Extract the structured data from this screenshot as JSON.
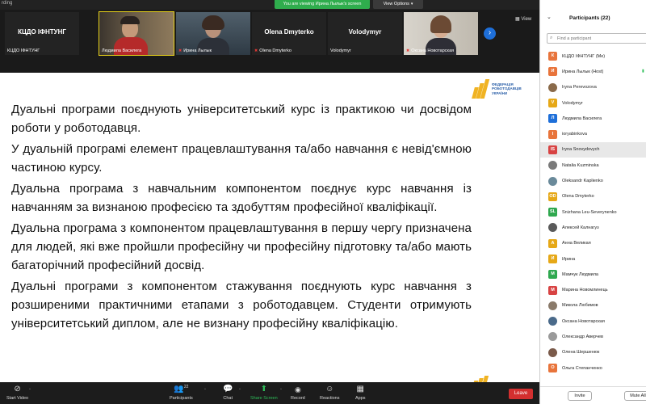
{
  "window": {
    "title": "rding"
  },
  "topbar": {
    "viewing_banner": "You are viewing Ирина Лылык's screen",
    "view_options": "View Options",
    "view_label": "View"
  },
  "gallery": {
    "recording_label": "rding",
    "tiles": [
      {
        "big_name": "КЦДО ІФНТУНГ",
        "label": "КЦДО ІФНТУНГ",
        "muted": false
      },
      {
        "big_name": "",
        "label": "Людмила Василега",
        "muted": false
      },
      {
        "big_name": "",
        "label": "Ирина Лылык",
        "muted": true
      },
      {
        "big_name": "Olena Dmyterko",
        "label": "Olena Dmyterko",
        "muted": true
      },
      {
        "big_name": "Volodymyr",
        "label": "Volodymyr",
        "muted": false
      },
      {
        "big_name": "",
        "label": "Оксана Новотарская",
        "muted": true
      }
    ]
  },
  "slide": {
    "logo_text": "ФЕДЕРАЦІЯ РОБОТОДАВЦІВ УКРАЇНИ",
    "paragraphs": [
      "Дуальні програми поєднують університетський курс із практикою чи досвідом роботи у роботодавця.",
      "У дуальній програмі елемент працевлаштування та/або навчання є невід'ємною частиною курсу.",
      "Дуальна програма з навчальним компонентом поєднує курс навчання із навчанням за визнаною професією та здобуттям професійної кваліфікації.",
      "Дуальна програма з компонентом працевлаштування в першу чергу призначена для людей, які вже пройшли професійну чи професійну підготовку та/або мають багаторічний професійний досвід.",
      "Дуальні програми з компонентом стажування поєднують курс навчання з розширеними практичними етапами з роботодавцем. Студенти отримують університетський диплом, але не визнану професійну кваліфікацію."
    ]
  },
  "toolbar": {
    "start_video": "Start Video",
    "participants": "Participants",
    "participants_count": "22",
    "chat": "Chat",
    "share_screen": "Share Screen",
    "record": "Record",
    "reactions": "Reactions",
    "apps": "Apps",
    "leave": "Leave"
  },
  "panel": {
    "title": "Participants (22)",
    "search_placeholder": "Find a participant",
    "invite": "Invite",
    "mute_all": "Mute All",
    "participants": [
      {
        "initial": "К",
        "color": "#e8743b",
        "name": "КЦДО ІФНТУНГ (Me)",
        "photo": false
      },
      {
        "initial": "И",
        "color": "#e8743b",
        "name": "Ирина Лылык (Host)",
        "photo": false
      },
      {
        "initial": "",
        "color": "#8a6a4a",
        "name": "Iryna Perevozova",
        "photo": true
      },
      {
        "initial": "V",
        "color": "#e6a817",
        "name": "Volodymyr",
        "photo": false
      },
      {
        "initial": "Л",
        "color": "#1e6fd9",
        "name": "Людмила Василега",
        "photo": false
      },
      {
        "initial": "I",
        "color": "#e8743b",
        "name": "ioryabinkova",
        "photo": false
      },
      {
        "initial": "IS",
        "color": "#d84343",
        "name": "Iryna Snovydovych",
        "photo": false
      },
      {
        "initial": "",
        "color": "#7a7a7a",
        "name": "Natalia Kuzminska",
        "photo": true
      },
      {
        "initial": "",
        "color": "#6a8a9a",
        "name": "Oleksandr Kaplienko",
        "photo": true
      },
      {
        "initial": "OD",
        "color": "#e6a817",
        "name": "Olena Dmyterko",
        "photo": false
      },
      {
        "initial": "SL",
        "color": "#2fa84f",
        "name": "Snizhana Leu-Severynenko",
        "photo": false
      },
      {
        "initial": "",
        "color": "#5a5a5a",
        "name": "Алексей Калнагуз",
        "photo": true
      },
      {
        "initial": "А",
        "color": "#e6a817",
        "name": "Анна Великая",
        "photo": false
      },
      {
        "initial": "И",
        "color": "#e6a817",
        "name": "Ирина",
        "photo": false
      },
      {
        "initial": "М",
        "color": "#2fa84f",
        "name": "Мамчук Людмила",
        "photo": false
      },
      {
        "initial": "М",
        "color": "#d84343",
        "name": "Марина Новомлинець",
        "photo": false
      },
      {
        "initial": "",
        "color": "#8a7a6a",
        "name": "Микола Любимов",
        "photo": true
      },
      {
        "initial": "",
        "color": "#4a6a8a",
        "name": "Оксана Новотарская",
        "photo": true
      },
      {
        "initial": "",
        "color": "#9a9a9a",
        "name": "Олександр Аверчев",
        "photo": true
      },
      {
        "initial": "",
        "color": "#7a5a4a",
        "name": "Олена Шершенюк",
        "photo": true
      },
      {
        "initial": "О",
        "color": "#e8743b",
        "name": "Ольга Степанченко",
        "photo": false
      }
    ]
  }
}
